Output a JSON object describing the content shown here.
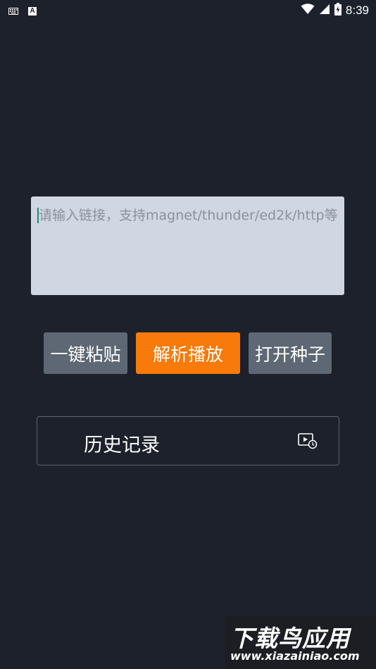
{
  "status_bar": {
    "time": "8:39",
    "left_icons": [
      "keyboard-icon",
      "a-notification-icon"
    ],
    "right_icons": [
      "wifi-icon",
      "signal-icon",
      "battery-charging-icon"
    ],
    "a_icon_letter": "A"
  },
  "link_input": {
    "value": "",
    "placeholder": "请输入链接，支持magnet/thunder/ed2k/http等"
  },
  "buttons": {
    "paste": "一键粘贴",
    "parse": "解析播放",
    "open_torrent": "打开种子"
  },
  "history": {
    "label": "历史记录",
    "icon": "video-history-icon"
  },
  "watermark": {
    "title": "下载鸟应用",
    "url": "www.xiazainiao.com"
  },
  "colors": {
    "background": "#1c212b",
    "input_bg": "#d0d6e2",
    "accent": "#f77a0a",
    "secondary_button": "#5d6874"
  }
}
